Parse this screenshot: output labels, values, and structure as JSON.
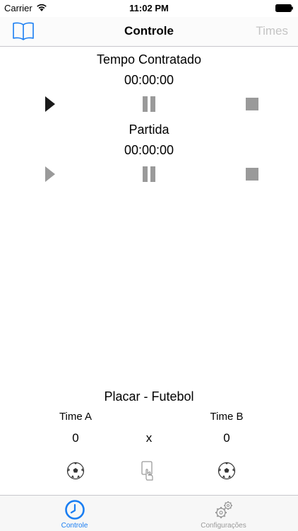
{
  "status_bar": {
    "carrier": "Carrier",
    "time": "11:02 PM"
  },
  "nav": {
    "title": "Controle",
    "right_button": "Times"
  },
  "contracted": {
    "title": "Tempo Contratado",
    "time": "00:00:00"
  },
  "match": {
    "title": "Partida",
    "time": "00:00:00"
  },
  "scoreboard": {
    "title": "Placar - Futebol",
    "team_a": "Time A",
    "team_b": "Time B",
    "score_a": "0",
    "score_b": "0",
    "separator": "x"
  },
  "tabs": [
    {
      "label": "Controle",
      "icon": "clock-icon",
      "active": true
    },
    {
      "label": "Configurações",
      "icon": "gears-icon",
      "active": false
    }
  ],
  "colors": {
    "accent": "#1a7ef2",
    "inactive": "#9a9a9a",
    "disabled": "#c4c4c4"
  }
}
